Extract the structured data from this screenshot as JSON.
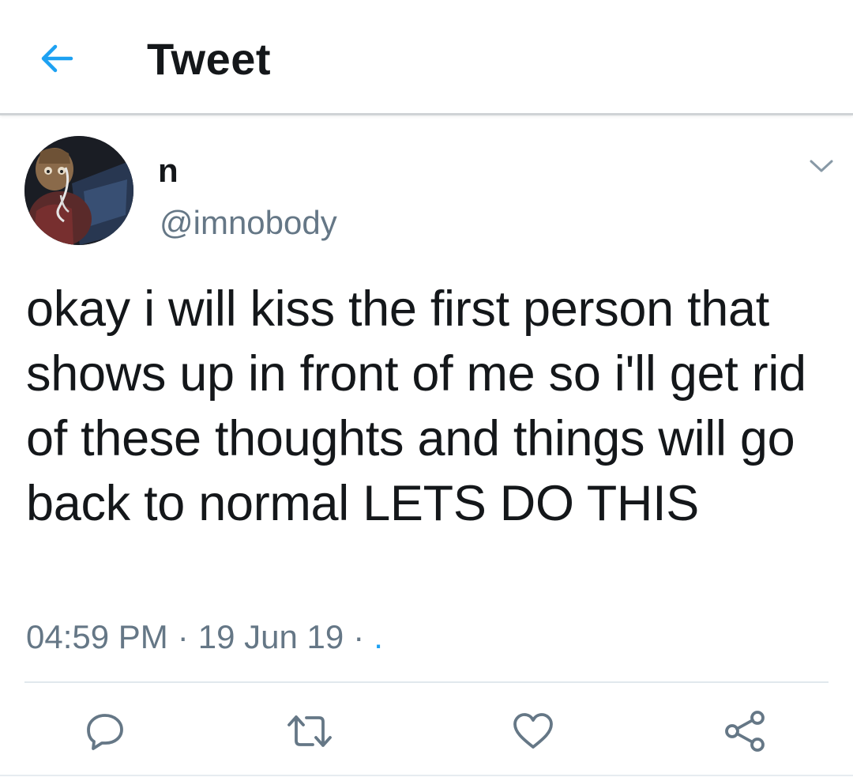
{
  "header": {
    "title": "Tweet",
    "back_icon": "arrow-left-icon",
    "accent_color": "#1da1f2"
  },
  "tweet": {
    "author": {
      "display_name": "n",
      "handle": "@imnobody"
    },
    "text": "okay i will kiss the first person that shows up in front of me so i'll get rid of these thoughts and things will go back to normal LETS DO THIS",
    "time": "04:59 PM",
    "separator": "·",
    "date": "19 Jun 19",
    "source": "."
  },
  "actions": [
    {
      "name": "reply",
      "icon": "reply-icon"
    },
    {
      "name": "retweet",
      "icon": "retweet-icon"
    },
    {
      "name": "like",
      "icon": "heart-icon"
    },
    {
      "name": "share",
      "icon": "share-icon"
    }
  ],
  "colors": {
    "text": "#14171a",
    "secondary": "#657786",
    "icon": "#657786",
    "accent": "#1da1f2",
    "divider": "#e1e8ed"
  }
}
